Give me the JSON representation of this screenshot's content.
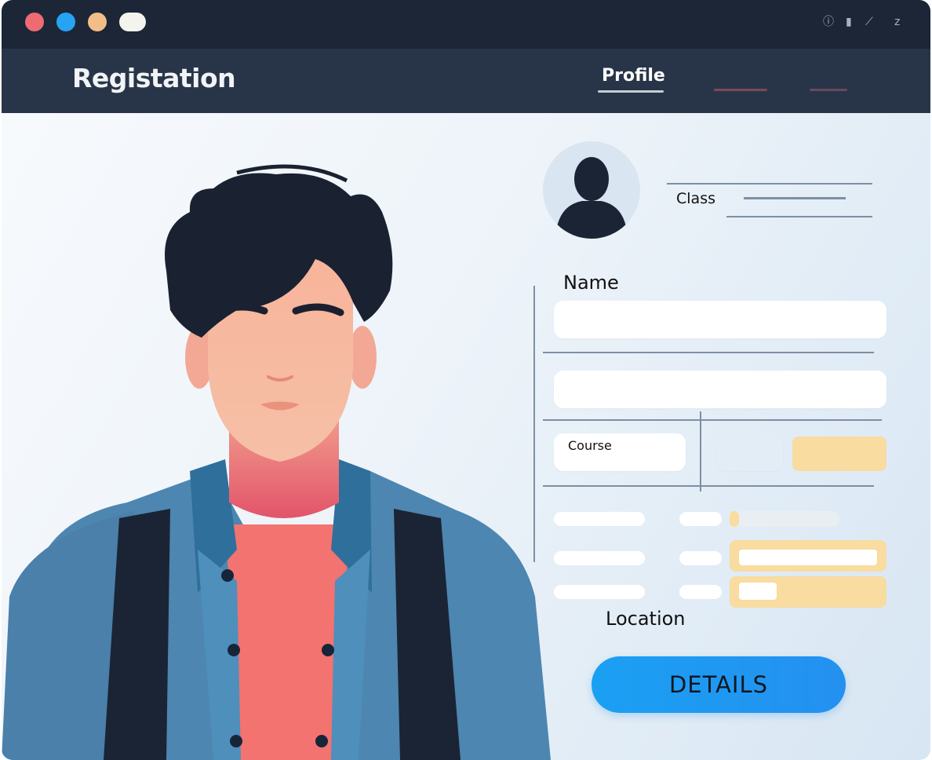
{
  "window": {
    "title_bar": {
      "icons": [
        "info-icon",
        "battery-icon",
        "signal-icon",
        "close-icon"
      ]
    },
    "header": {
      "app_title": "Registation",
      "nav": [
        {
          "label": "Profile",
          "active": true
        }
      ]
    }
  },
  "profile": {
    "class_label": "Class",
    "name_label": "Name",
    "name_value": "",
    "second_value": "",
    "course_label": "Course",
    "location_label": "Location",
    "details_button": "DETAILS"
  },
  "colors": {
    "titlebar": "#1c2637",
    "header": "#283548",
    "accent": "#1aa0f3",
    "highlight": "#f8dca0"
  }
}
